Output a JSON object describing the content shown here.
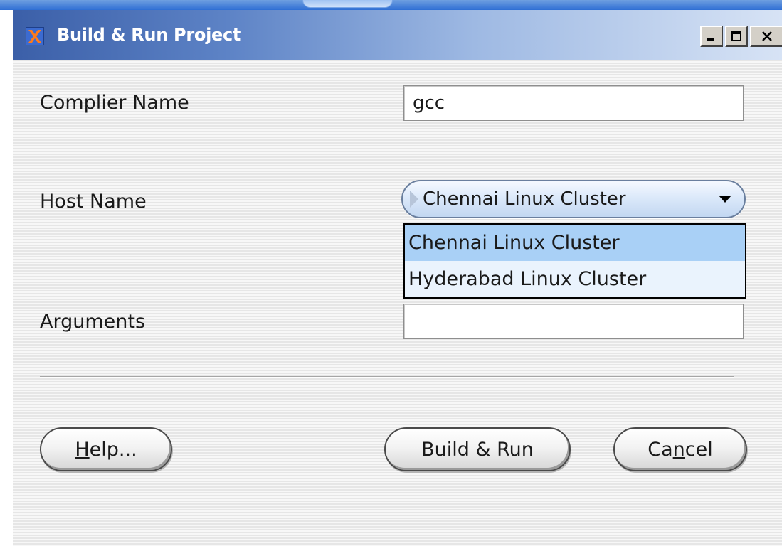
{
  "window": {
    "title": "Build & Run Project",
    "controls": [
      "minimize-icon",
      "maximize-icon",
      "close-icon"
    ]
  },
  "form": {
    "compiler_label": "Complier Name",
    "compiler_value": "gcc",
    "host_label": "Host Name",
    "host_selected": "Chennai Linux Cluster",
    "host_options": [
      "Chennai Linux Cluster",
      "Hyderabad Linux Cluster"
    ],
    "arguments_label": "Arguments",
    "arguments_value": ""
  },
  "buttons": {
    "help_prefix": "H",
    "help_rest": "elp...",
    "build_run": "Build & Run",
    "cancel_before": "Ca",
    "cancel_mnemonic": "n",
    "cancel_after": "cel"
  },
  "colors": {
    "title_bar_start": "#3b5fa8",
    "selection": "#a9d0f6",
    "dropdown_bg": "#eaf3fd"
  }
}
